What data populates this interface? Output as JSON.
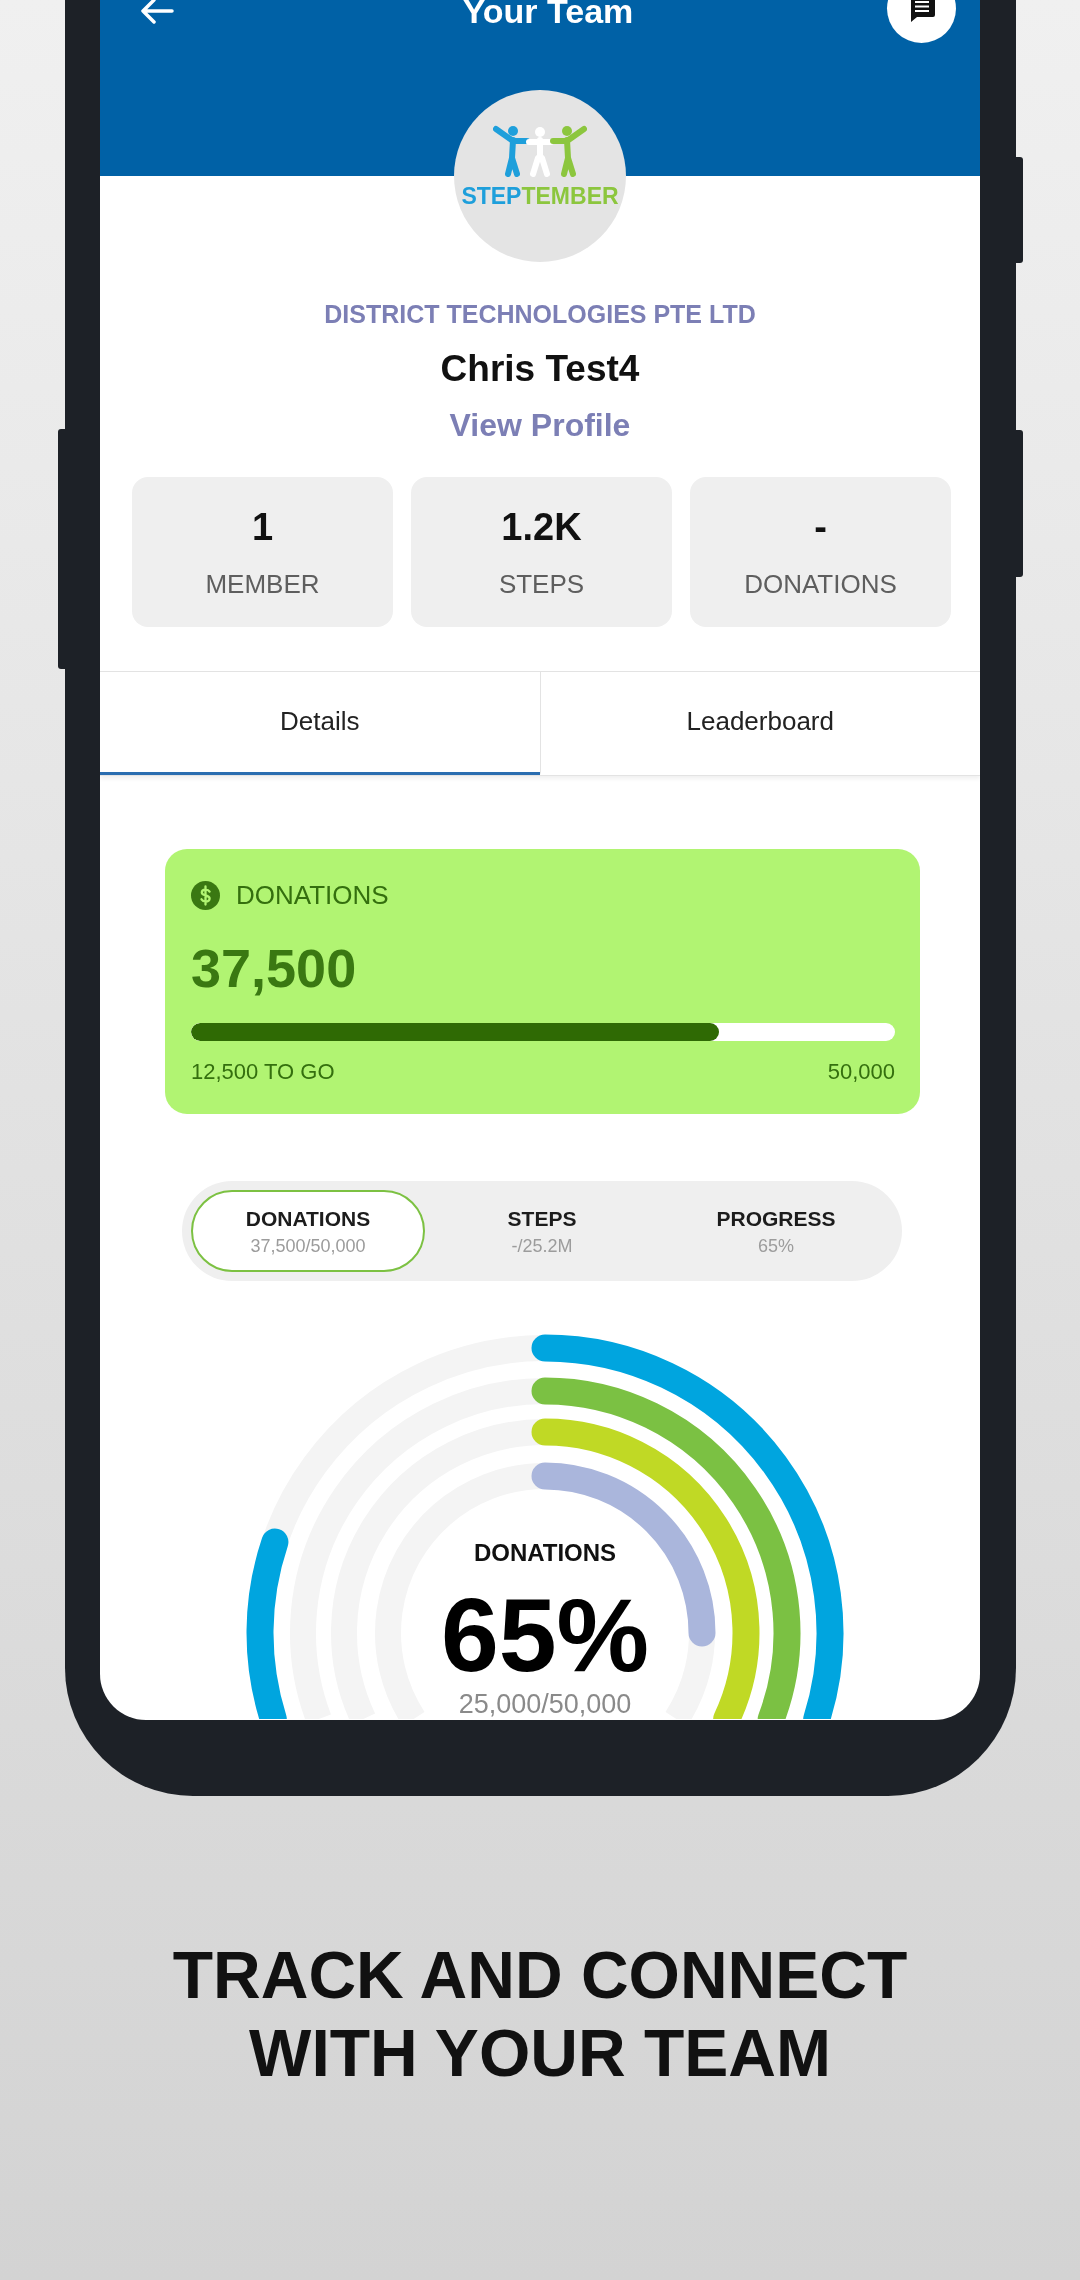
{
  "header": {
    "title": "Your Team"
  },
  "logo": {
    "wordmark": [
      {
        "text": "STEP",
        "color": "#1e9fdb"
      },
      {
        "text": "TEMBER",
        "color": "#8cc63e"
      }
    ]
  },
  "team": {
    "organisation": "DISTRICT TECHNOLOGIES PTE LTD",
    "name": "Chris Test4",
    "profile_link": "View Profile"
  },
  "stats": [
    {
      "value": "1",
      "label": "MEMBER"
    },
    {
      "value": "1.2K",
      "label": "STEPS"
    },
    {
      "value": "-",
      "label": "DONATIONS"
    }
  ],
  "tabs": [
    {
      "label": "Details",
      "selected": true
    },
    {
      "label": "Leaderboard",
      "selected": false
    }
  ],
  "donations_card": {
    "title": "DONATIONS",
    "amount": "37,500",
    "level": 0.75,
    "remaining": "12,500 TO GO",
    "target": "50,000"
  },
  "segments": [
    {
      "label": "DONATIONS",
      "value": "37,500/50,000",
      "selected": true
    },
    {
      "label": "STEPS",
      "value": "-/25.2M",
      "selected": false
    },
    {
      "label": "PROGRESS",
      "value": "65%",
      "selected": false
    }
  ],
  "rings": {
    "title": "DONATIONS",
    "percent": "65%",
    "reading": "25,000/50,000"
  },
  "headline": "TRACK AND CONNECT WITH YOUR TEAM"
}
